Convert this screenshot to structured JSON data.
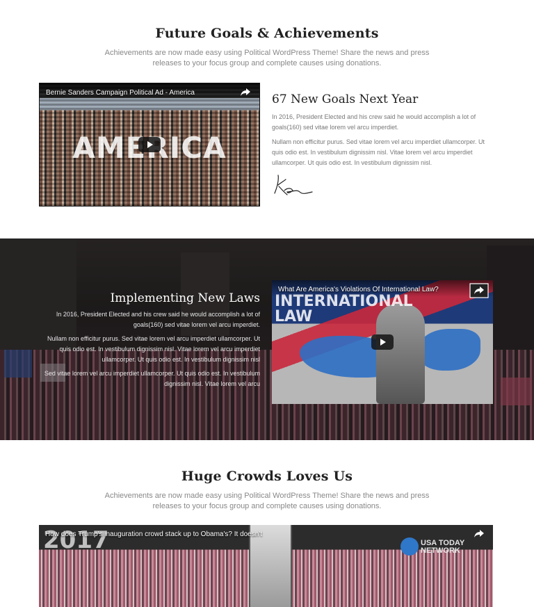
{
  "section1": {
    "title": "Future Goals & Achievements",
    "subtitle_line1": "Achievements are now made easy using Political WordPress Theme! Share the news and press",
    "subtitle_line2": "releases to your focus group and complete causes using donations."
  },
  "video1": {
    "title": "Bernie Sanders Campaign Political Ad - America",
    "overlay_text": "AMERICA"
  },
  "goals": {
    "title": "67 New Goals Next Year",
    "para1": "In 2016, President Elected and his crew said he would accomplish a lot of goals(160) sed vitae lorem vel arcu imperdiet.",
    "para2": "Nullam non efficitur purus. Sed vitae lorem vel arcu imperdiet ullamcorper. Ut quis odio est. In vestibulum dignissim nisl. Vitae lorem vel arcu imperdiet ullamcorper. Ut quis odio est. In vestibulum dignissim nisl."
  },
  "laws": {
    "title": "Implementing New Laws",
    "para1": "In 2016, President Elected and his crew said he would accomplish a lot of goals(160) sed vitae lorem vel arcu imperdiet.",
    "para2": "Nullam non efficitur purus. Sed vitae lorem vel arcu imperdiet ullamcorper. Ut quis odio est. In vestibulum dignissim nisl. Vitae lorem vel arcu imperdiet ullamcorper. Ut quis odio est. In vestibulum dignissim nisl",
    "para3": "Sed vitae lorem vel arcu imperdiet ullamcorper. Ut quis odio est. In vestibulum dignissim nisl. Vitae lorem vel arcu"
  },
  "video2": {
    "title": "What Are America's Violations Of International Law?",
    "overlay_line1": "INTERNATIONAL",
    "overlay_line2": "LAW"
  },
  "section2": {
    "title": "Huge Crowds Loves Us",
    "subtitle_line1": "Achievements are now made easy using Political WordPress Theme! Share the news and press",
    "subtitle_line2": "releases to your focus group and complete causes using donations."
  },
  "video3": {
    "title": "How does Trump's inauguration crowd stack up to Obama's? It doesn't",
    "overlay_year": "2017",
    "network_line1": "USA TODAY",
    "network_line2": "NETWORK"
  },
  "colors": {
    "heading": "#222222",
    "body_text": "#777777",
    "band_dark": "#2c2828"
  },
  "icons": [
    "share-icon",
    "play-icon",
    "signature-icon",
    "usa-today-logo-icon"
  ]
}
